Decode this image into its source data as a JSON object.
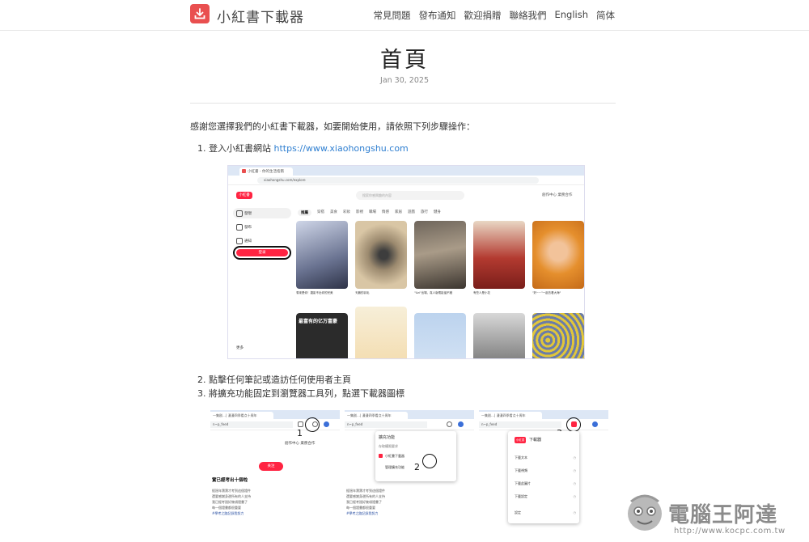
{
  "header": {
    "site_title": "小紅書下載器",
    "nav": [
      "常見問題",
      "發布通知",
      "歡迎捐贈",
      "聯絡我們",
      "English",
      "简体"
    ]
  },
  "main": {
    "title": "首頁",
    "date": "Jan 30, 2025",
    "intro": "感謝您選擇我們的小紅書下載器，如要開始使用，請依照下列步驟操作：",
    "step1_prefix": "1. 登入小紅書網站 ",
    "step1_link": "https://www.xiaohongshu.com",
    "step2": "2. 點擊任何筆記或造訪任何使用者主頁",
    "step3": "3. 將擴充功能固定到瀏覽器工具列，點選下載器圖標"
  },
  "screenshot1": {
    "tab_title": "小紅書 - 你的生活指南",
    "url": "xiaohongshu.com/explore",
    "logo": "小紅書",
    "search_placeholder": "搜索你感興趣的內容",
    "top_right": "創作中心   業務合作",
    "sidebar": [
      "發現",
      "發布",
      "通知"
    ],
    "login_label": "登录",
    "more_label": "更多",
    "categories": [
      "推薦",
      "穿搭",
      "美食",
      "彩妝",
      "影視",
      "職場",
      "情感",
      "家居",
      "遊戲",
      "旅行",
      "健身"
    ],
    "captions": [
      "原來是你！攝影不出你的完美",
      "天鵝的羽毛",
      "\"Uzi\"出場，真人版電影還不錯",
      "有些人是小花",
      "\"好~~\"一起去看大海\""
    ],
    "banner_text": "最富有的亿万富豪"
  },
  "screenshot2": {
    "tab_title": "一集剧…| 漫漫四季看点十周年",
    "url": "n~p_feed",
    "top_right": "創作中心  業務合作",
    "follow_label": "关注",
    "heading": "實已經考出十個啦",
    "body_lines": [
      "經過年寶寶才考到這個證件",
      "還要感謝身邊所有的人支持",
      "我已經考過好幾項證書了",
      "每一個證書都很重要"
    ],
    "body_tag": "#學考之路記錄我努力",
    "popup_title": "擴充功能",
    "popup_subtitle": "存取權限要求",
    "popup_item": "小紅書下載器",
    "popup_manage": "管理擴充功能",
    "menu_title": "下載器",
    "menu_items": [
      "下載文本",
      "下載視頻",
      "下載此圖片",
      "下載設定",
      "設定"
    ],
    "labels": [
      "1",
      "2",
      "3"
    ]
  },
  "watermark": {
    "text": "電腦王阿達",
    "url": "http://www.kocpc.com.tw"
  },
  "colors": {
    "brand": "#e94f4f",
    "xhs_red": "#ff2442",
    "link": "#2f7fd1"
  }
}
